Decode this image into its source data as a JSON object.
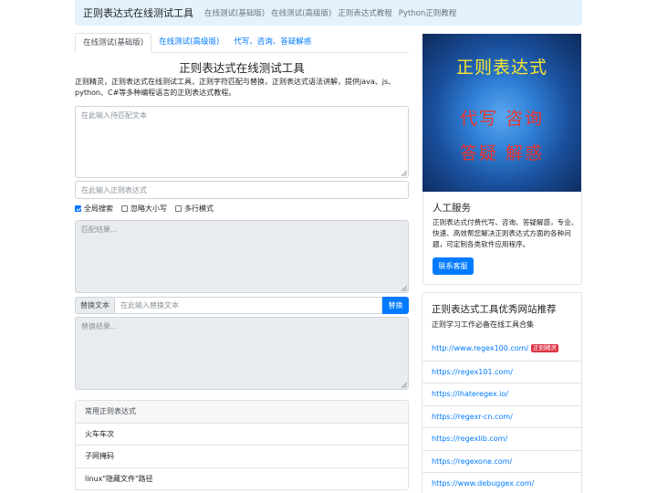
{
  "navbar": {
    "brand": "正则表达式在线测试工具",
    "links": [
      "在线测试(基础版)",
      "在线测试(高级版)",
      "正则表达式教程",
      "Python正则教程"
    ]
  },
  "tabs": [
    "在线测试(基础版)",
    "在线测试(高级版)",
    "代写、咨询、答疑解惑"
  ],
  "main": {
    "title": "正则表达式在线测试工具",
    "intro": "正则精灵，正则表达式在线测试工具，正则字符匹配与替换，正则表达式语法讲解，提供java、js、python、C#等多种编程语言的正则表达式教程。",
    "text_placeholder": "在此输入待匹配文本",
    "regex_placeholder": "在此输入正则表达式",
    "options": [
      {
        "label": "全局搜索",
        "checked": true
      },
      {
        "label": "忽略大小写",
        "checked": false
      },
      {
        "label": "多行模式",
        "checked": false
      }
    ],
    "match_result_placeholder": "匹配结果...",
    "replace_label": "替换文本",
    "replace_placeholder": "在此输入替换文本",
    "replace_button": "替换",
    "replace_result_placeholder": "替换结果..."
  },
  "common_list": {
    "header": "常用正则表达式",
    "items": [
      "火车车次",
      "子网掩码",
      "linux\"隐藏文件\"路径"
    ]
  },
  "ad": {
    "line1": "正则表达式",
    "line2": "代写 咨询",
    "line3": "答疑 解惑",
    "colors": {
      "line1": "#f7e830",
      "line2": "#e8352e",
      "background": "#1a4f9c"
    }
  },
  "service": {
    "title": "人工服务",
    "text": "正则表达式付费代写、咨询、答疑解惑，专业、快速、高效帮您解决正则表达式方面的各种问题，可定制各类软件应用程序。",
    "button": "联系客服"
  },
  "sites": {
    "title": "正则表达式工具优秀网站推荐",
    "subtitle": "正则学习工作必备在线工具合集",
    "items": [
      {
        "url": "http://www.regex100.com/",
        "badge": "正则精灵"
      },
      {
        "url": "https://regex101.com/"
      },
      {
        "url": "https://ihateregex.io/"
      },
      {
        "url": "https://regexr-cn.com/"
      },
      {
        "url": "https://regexlib.com/"
      },
      {
        "url": "https://regexone.com/"
      },
      {
        "url": "https://www.debuggex.com/"
      }
    ]
  },
  "colors": {
    "primary": "#007bff",
    "navbar_bg": "#e3f2fd",
    "badge": "#dc3545"
  }
}
